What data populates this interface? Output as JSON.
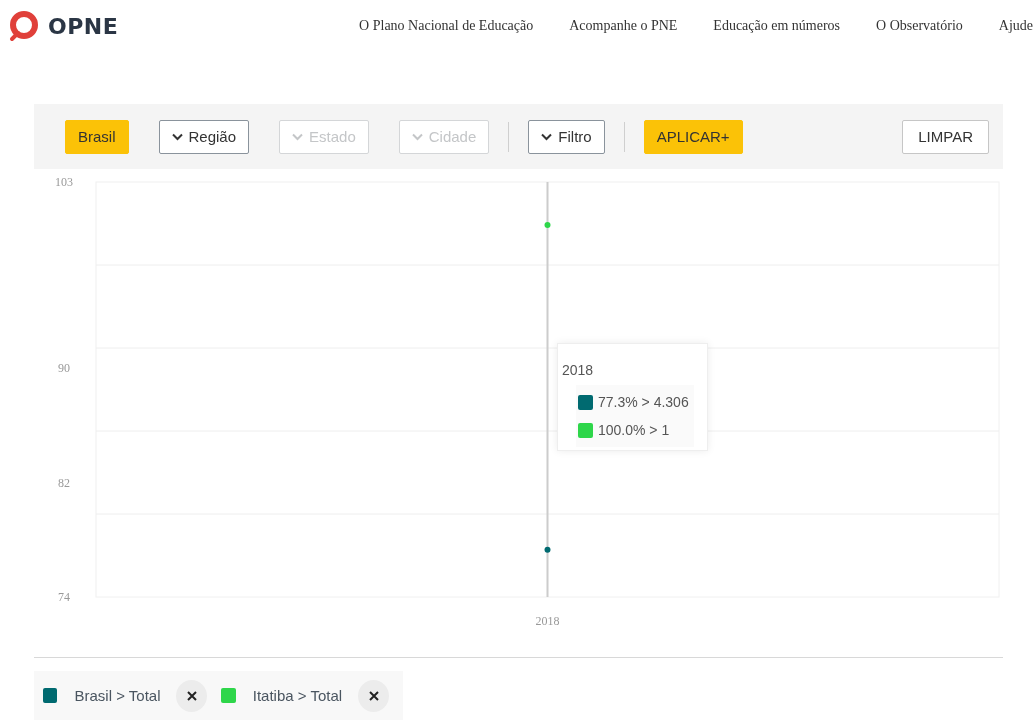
{
  "header": {
    "logo_text": "OPNE",
    "nav": [
      "O Plano Nacional de Educação",
      "Acompanhe o PNE",
      "Educação em números",
      "O Observatório",
      "Ajude"
    ]
  },
  "toolbar": {
    "items": [
      {
        "kind": "primary",
        "label": "Brasil",
        "disabled": false
      },
      {
        "kind": "dropdown",
        "label": "Região",
        "disabled": false
      },
      {
        "kind": "dropdown",
        "label": "Estado",
        "disabled": true
      },
      {
        "kind": "dropdown",
        "label": "Cidade",
        "disabled": true
      },
      {
        "kind": "divider"
      },
      {
        "kind": "dropdown",
        "label": "Filtro",
        "disabled": false
      },
      {
        "kind": "divider"
      },
      {
        "kind": "primary",
        "label": "APLICAR+",
        "disabled": false
      },
      {
        "kind": "secondary",
        "label": "LIMPAR",
        "disabled": false
      }
    ]
  },
  "chart": {
    "chart_data": {
      "type": "line",
      "categories": [
        "2018"
      ],
      "ylim": [
        74,
        103
      ],
      "yticks": [
        74,
        82,
        90,
        103
      ],
      "series": [
        {
          "name": "Brasil > Total",
          "color": "#006a70",
          "marker": "circle",
          "values": [
            77.3
          ]
        },
        {
          "name": "Itatiba > Total",
          "color": "#2ed64a",
          "marker": "circle",
          "values": [
            100.0
          ]
        }
      ]
    },
    "tooltip": {
      "title": "2018",
      "items": [
        {
          "label": "77.3% > 4.306",
          "color": "#006a70"
        },
        {
          "label": "100.0% > 1",
          "color": "#2ed64a"
        }
      ]
    }
  }
}
